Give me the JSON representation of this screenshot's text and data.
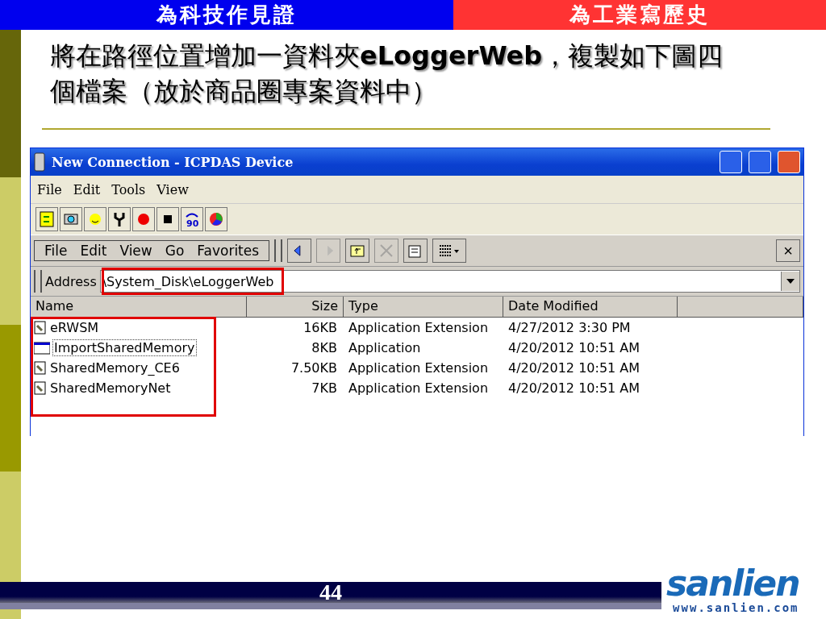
{
  "header": {
    "left": "為科技作見證",
    "right": "為工業寫歷史"
  },
  "title": {
    "text": "將在路徑位置增加一資料夾**eLoggerWeb**，複製如下圖四個檔案（放於商品圈專案資料中）"
  },
  "window": {
    "title": "New Connection - ICPDAS Device",
    "menu": [
      "File",
      "Edit",
      "Tools",
      "View"
    ],
    "toolbar": [
      {
        "kind": "refresh"
      },
      {
        "kind": "camera"
      },
      {
        "kind": "smiley"
      },
      {
        "kind": "tool"
      },
      {
        "kind": "record"
      },
      {
        "kind": "stop"
      },
      {
        "kind": "rotate",
        "label": "90"
      },
      {
        "kind": "chart"
      }
    ],
    "command_menu": [
      "File",
      "Edit",
      "View",
      "Go",
      "Favorites"
    ],
    "command_buttons": [
      {
        "kind": "back",
        "disabled": false
      },
      {
        "kind": "forward",
        "disabled": true
      },
      {
        "kind": "up",
        "disabled": false
      },
      {
        "kind": "delete",
        "disabled": true
      },
      {
        "kind": "properties",
        "disabled": false
      },
      {
        "kind": "views",
        "disabled": false
      }
    ],
    "close_label": "×",
    "address": {
      "label": "Address",
      "value": "\\System_Disk\\eLoggerWeb"
    },
    "columns": [
      "Name",
      "Size",
      "Type",
      "Date Modified"
    ],
    "rows": [
      {
        "kind": "extension",
        "name": "eRWSM",
        "size": "16KB",
        "type": "Application Extension",
        "date": "4/27/2012 3:30 PM",
        "focused": false
      },
      {
        "kind": "application",
        "name": "ImportSharedMemory",
        "size": "8KB",
        "type": "Application",
        "date": "4/20/2012 10:51 AM",
        "focused": true
      },
      {
        "kind": "extension",
        "name": "SharedMemory_CE6",
        "size": "7.50KB",
        "type": "Application Extension",
        "date": "4/20/2012 10:51 AM",
        "focused": false
      },
      {
        "kind": "extension",
        "name": "SharedMemoryNet",
        "size": "7KB",
        "type": "Application Extension",
        "date": "4/20/2012 10:51 AM",
        "focused": false
      }
    ]
  },
  "footer": {
    "page": "44",
    "logo": "sanlien",
    "url": "www.sanlien.com"
  }
}
